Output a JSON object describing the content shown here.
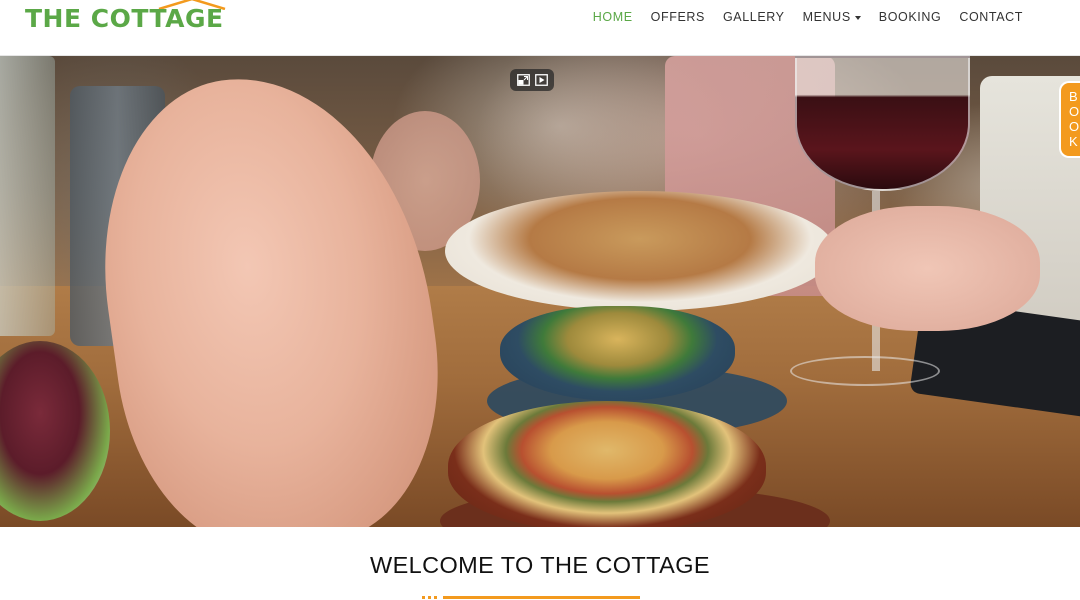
{
  "brand": {
    "name": "THE COTTAGE",
    "color": "#5ba847",
    "roof_color": "#f39a1e"
  },
  "nav": {
    "items": [
      {
        "label": "HOME",
        "active": true
      },
      {
        "label": "OFFERS",
        "active": false
      },
      {
        "label": "GALLERY",
        "active": false
      },
      {
        "label": "MENUS",
        "active": false,
        "has_dropdown": true
      },
      {
        "label": "BOOKING",
        "active": false
      },
      {
        "label": "CONTACT",
        "active": false
      }
    ],
    "active_color": "#5ba847"
  },
  "hero": {
    "media": "restaurant-dining-video",
    "controls": [
      "picture-in-picture-icon",
      "video-play-icon"
    ]
  },
  "side_tab": {
    "label": "BOOK",
    "letters": [
      "B",
      "O",
      "O",
      "K"
    ],
    "color": "#f39a1e"
  },
  "welcome": {
    "heading": "WELCOME TO THE COTTAGE",
    "accent_color": "#f39a1e"
  }
}
